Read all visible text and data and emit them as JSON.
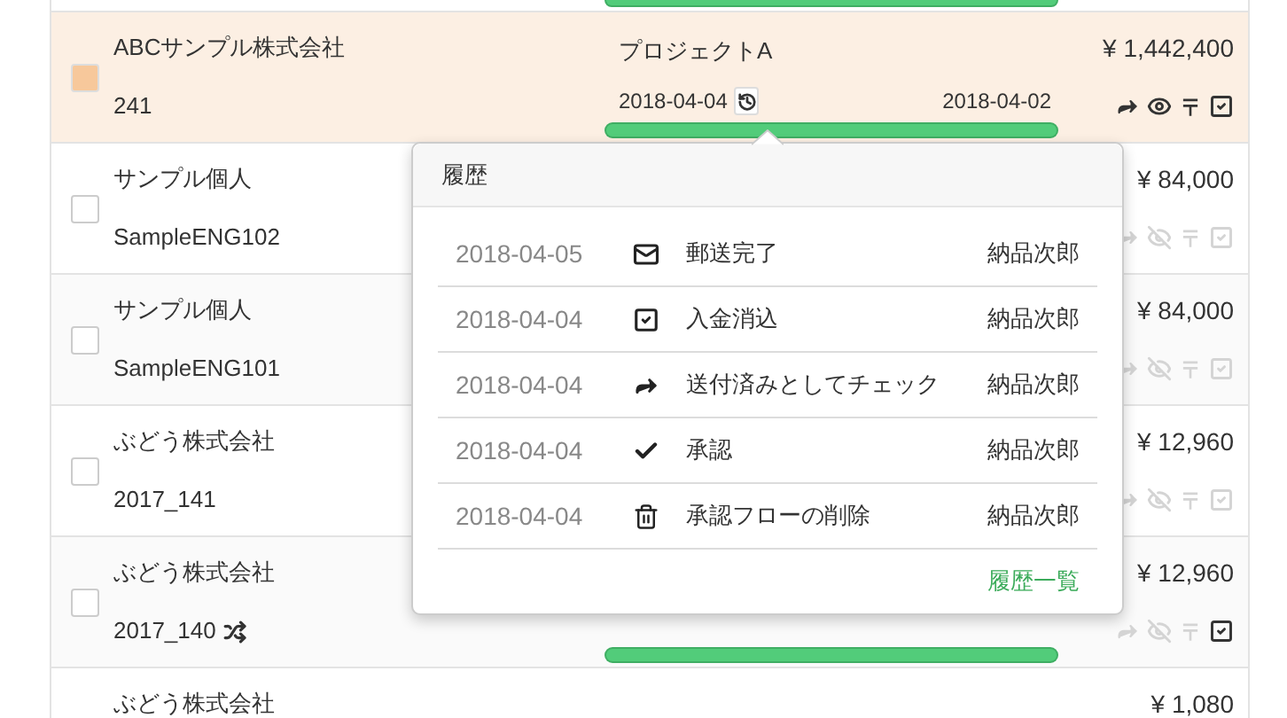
{
  "row_above": {
    "level": 1
  },
  "rows": [
    {
      "name": "ABCサンプル株式会社",
      "code": "241",
      "level": 1,
      "project": "プロジェクトA",
      "start_date": "2018-04-04",
      "end_date": "2018-04-02",
      "amount": "¥ 1,442,400",
      "selected": true,
      "linked": false,
      "actions": [
        {
          "kind": "send",
          "enabled": true
        },
        {
          "kind": "view",
          "enabled": true
        },
        {
          "kind": "post",
          "enabled": true
        },
        {
          "kind": "check",
          "enabled": true
        }
      ]
    },
    {
      "name": "サンプル個人",
      "code": "SampleENG102",
      "amount": "¥ 84,000",
      "selected": false,
      "linked": false,
      "actions": [
        {
          "kind": "send",
          "enabled": false
        },
        {
          "kind": "view",
          "enabled": false
        },
        {
          "kind": "post",
          "enabled": false
        },
        {
          "kind": "check",
          "enabled": false
        }
      ]
    },
    {
      "name": "サンプル個人",
      "code": "SampleENG101",
      "amount": "¥ 84,000",
      "selected": false,
      "linked": false,
      "actions": [
        {
          "kind": "send",
          "enabled": false
        },
        {
          "kind": "view",
          "enabled": false
        },
        {
          "kind": "post",
          "enabled": false
        },
        {
          "kind": "check",
          "enabled": false
        }
      ]
    },
    {
      "name": "ぶどう株式会社",
      "code": "2017_141",
      "amount": "¥ 12,960",
      "selected": false,
      "linked": false,
      "actions": [
        {
          "kind": "send",
          "enabled": false
        },
        {
          "kind": "view",
          "enabled": false
        },
        {
          "kind": "post",
          "enabled": false
        },
        {
          "kind": "check",
          "enabled": false
        }
      ]
    },
    {
      "name": "ぶどう株式会社",
      "code": "2017_140",
      "level": 1,
      "amount": "¥ 12,960",
      "selected": false,
      "linked": true,
      "actions": [
        {
          "kind": "send",
          "enabled": false
        },
        {
          "kind": "view",
          "enabled": false
        },
        {
          "kind": "post",
          "enabled": false
        },
        {
          "kind": "check",
          "enabled": true
        }
      ]
    },
    {
      "name": "ぶどう株式会社",
      "amount": "¥ 1,080",
      "selected": false,
      "linked": false
    }
  ],
  "history_popover": {
    "title": "履歴",
    "entries": [
      {
        "date": "2018-04-05",
        "kind": "mail",
        "action": "郵送完了",
        "user": "納品次郎"
      },
      {
        "date": "2018-04-04",
        "kind": "check-square",
        "action": "入金消込",
        "user": "納品次郎"
      },
      {
        "date": "2018-04-04",
        "kind": "send",
        "action": "送付済みとしてチェック",
        "user": "納品次郎"
      },
      {
        "date": "2018-04-04",
        "kind": "approve",
        "action": "承認",
        "user": "納品次郎"
      },
      {
        "date": "2018-04-04",
        "kind": "delete",
        "action": "承認フローの削除",
        "user": "納品次郎"
      }
    ],
    "link": "履歴一覧"
  }
}
